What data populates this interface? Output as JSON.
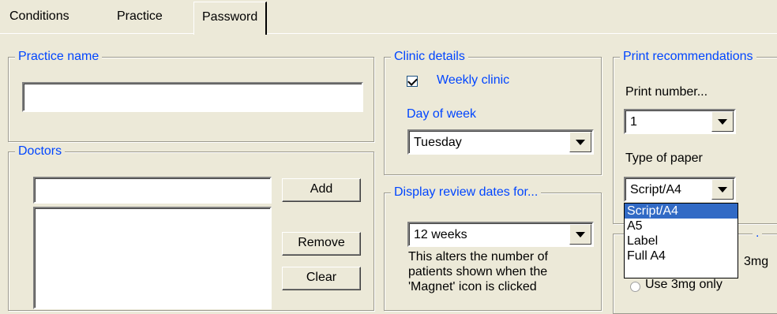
{
  "tabs": [
    {
      "label": "Conditions"
    },
    {
      "label": "Practice"
    },
    {
      "label": "Password"
    }
  ],
  "practice_name": {
    "legend": "Practice name",
    "value": ""
  },
  "doctors": {
    "legend": "Doctors",
    "input_value": "",
    "add_label": "Add",
    "remove_label": "Remove",
    "clear_label": "Clear"
  },
  "clinic": {
    "legend": "Clinic details",
    "weekly_clinic_label": "Weekly clinic",
    "weekly_clinic_checked": true,
    "day_of_week_label": "Day of week",
    "day_of_week_value": "Tuesday"
  },
  "review": {
    "legend": "Display review dates for...",
    "value": "12 weeks",
    "help_line1": "This alters the number of",
    "help_line2": "patients shown when the",
    "help_line3": "'Magnet' icon is clicked"
  },
  "print": {
    "legend": "Print recommendations",
    "print_number_label": "Print number...",
    "print_number_value": "1",
    "type_of_paper_label": "Type of paper",
    "type_of_paper_value": "Script/A4",
    "paper_options": [
      "Script/A4",
      "A5",
      "Label",
      "Full A4"
    ],
    "selected_option": "Script/A4"
  },
  "dose": {
    "legend": ".",
    "partial_3mg": "3mg",
    "use_3mg_only": "Use 3mg only"
  }
}
